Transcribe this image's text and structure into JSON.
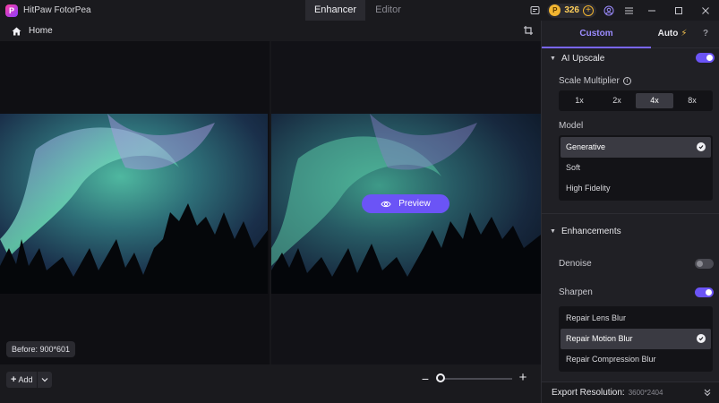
{
  "app": {
    "name": "HitPaw FotorPea",
    "logo_letter": "P"
  },
  "main_tabs": [
    {
      "label": "Enhancer",
      "active": true
    },
    {
      "label": "Editor",
      "active": false
    }
  ],
  "titlebar": {
    "coins": "326",
    "coin_symbol": "P",
    "coin_plus": "+"
  },
  "homebar": {
    "home_label": "Home"
  },
  "canvas": {
    "preview_label": "Preview",
    "before_badge": "Before: 900*601"
  },
  "bottombar": {
    "add_label": "Add",
    "add_plus": "+",
    "zoom_minus": "−",
    "zoom_plus": "+",
    "zoom_level": 0.0
  },
  "panel": {
    "tabs": {
      "custom": "Custom",
      "auto": "Auto",
      "auto_bolt": "⚡",
      "help": "?"
    },
    "ai_upscale": {
      "title": "AI Upscale",
      "enabled": true,
      "scale_label": "Scale Multiplier",
      "scale_options": [
        "1x",
        "2x",
        "4x",
        "8x"
      ],
      "scale_selected": "4x",
      "model_label": "Model",
      "models": [
        "Generative",
        "Soft",
        "High Fidelity"
      ],
      "model_selected": "Generative"
    },
    "enhancements": {
      "title": "Enhancements",
      "denoise_label": "Denoise",
      "denoise_enabled": false,
      "sharpen_label": "Sharpen",
      "sharpen_enabled": true,
      "sharpen_options": [
        "Repair Lens Blur",
        "Repair Motion Blur",
        "Repair Compression Blur"
      ],
      "sharpen_selected": "Repair Motion Blur"
    },
    "export": {
      "label": "Export Resolution:",
      "value": "3600*2404"
    }
  },
  "colors": {
    "accent": "#6b54f6",
    "accent_text": "#9c8cff",
    "coin": "#f2b531",
    "panel_bg": "#202025"
  }
}
